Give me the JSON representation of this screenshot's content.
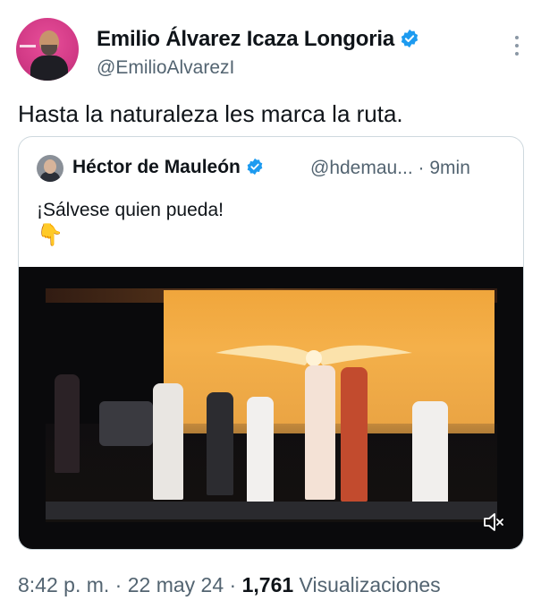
{
  "author": {
    "name": "Emilio Álvarez Icaza Longoria",
    "handle": "@EmilioAlvarezI",
    "verified_color": "#1d9bf0"
  },
  "tweet": {
    "text": "Hasta la naturaleza les marca la ruta."
  },
  "quote": {
    "name": "Héctor de Mauleón",
    "handle_time": "@hdemau... · 9min",
    "text": "¡Sálvese quien pueda!",
    "emoji": "👇",
    "video_icon": "mute-icon"
  },
  "footer": {
    "time": "8:42 p. m.",
    "sep1": " · ",
    "date": "22 may 24",
    "sep2": " · ",
    "views_count": "1,761",
    "views_label": " Visualizaciones"
  },
  "icons": [
    "verified-badge-icon",
    "more-options-icon",
    "mute-icon"
  ]
}
